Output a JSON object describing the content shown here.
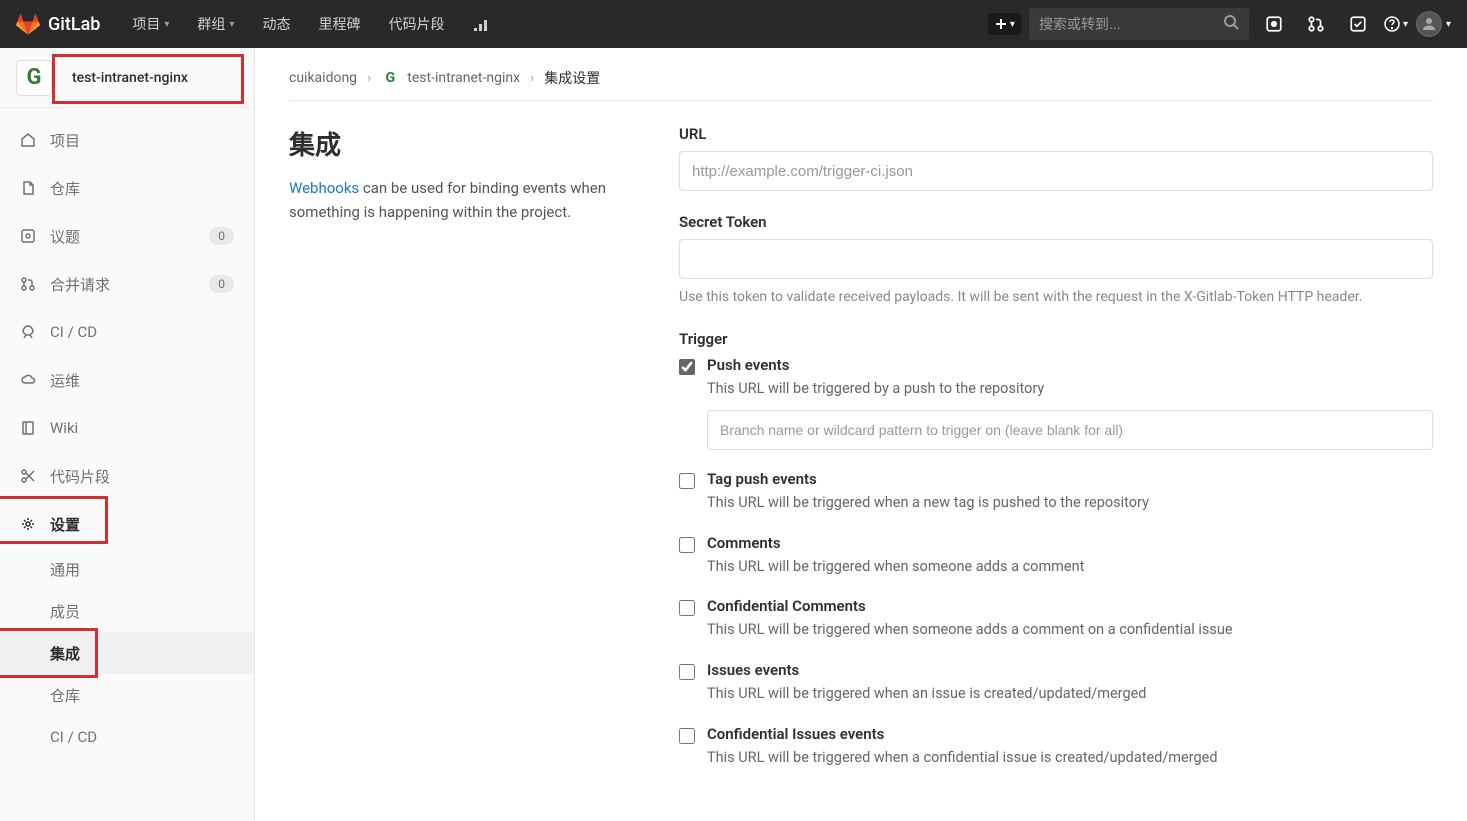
{
  "brand": "GitLab",
  "topnav": {
    "items": [
      "项目",
      "群组",
      "动态",
      "里程碑",
      "代码片段"
    ],
    "search_placeholder": "搜索或转到..."
  },
  "sidebar": {
    "project_name": "test-intranet-nginx",
    "items": [
      {
        "icon": "home",
        "label": "项目",
        "badge": null
      },
      {
        "icon": "doc",
        "label": "仓库",
        "badge": null
      },
      {
        "icon": "issues",
        "label": "议题",
        "badge": "0"
      },
      {
        "icon": "mr",
        "label": "合并请求",
        "badge": "0"
      },
      {
        "icon": "rocket",
        "label": "CI / CD",
        "badge": null
      },
      {
        "icon": "cloud",
        "label": "运维",
        "badge": null
      },
      {
        "icon": "book",
        "label": "Wiki",
        "badge": null
      },
      {
        "icon": "scissors",
        "label": "代码片段",
        "badge": null
      },
      {
        "icon": "gear",
        "label": "设置",
        "badge": null
      }
    ],
    "settings_sub": [
      "通用",
      "成员",
      "集成",
      "仓库",
      "CI / CD"
    ]
  },
  "breadcrumb": {
    "user": "cuikaidong",
    "project": "test-intranet-nginx",
    "page": "集成设置"
  },
  "main": {
    "title": "集成",
    "intro_link": "Webhooks",
    "intro_rest": " can be used for binding events when something is happening within the project."
  },
  "form": {
    "url_label": "URL",
    "url_placeholder": "http://example.com/trigger-ci.json",
    "secret_label": "Secret Token",
    "secret_help": "Use this token to validate received payloads. It will be sent with the request in the X-Gitlab-Token HTTP header.",
    "trigger_label": "Trigger",
    "branch_placeholder": "Branch name or wildcard pattern to trigger on (leave blank for all)",
    "triggers": [
      {
        "checked": true,
        "title": "Push events",
        "desc": "This URL will be triggered by a push to the repository",
        "has_input": true
      },
      {
        "checked": false,
        "title": "Tag push events",
        "desc": "This URL will be triggered when a new tag is pushed to the repository"
      },
      {
        "checked": false,
        "title": "Comments",
        "desc": "This URL will be triggered when someone adds a comment"
      },
      {
        "checked": false,
        "title": "Confidential Comments",
        "desc": "This URL will be triggered when someone adds a comment on a confidential issue"
      },
      {
        "checked": false,
        "title": "Issues events",
        "desc": "This URL will be triggered when an issue is created/updated/merged"
      },
      {
        "checked": false,
        "title": "Confidential Issues events",
        "desc": "This URL will be triggered when a confidential issue is created/updated/merged"
      }
    ]
  }
}
